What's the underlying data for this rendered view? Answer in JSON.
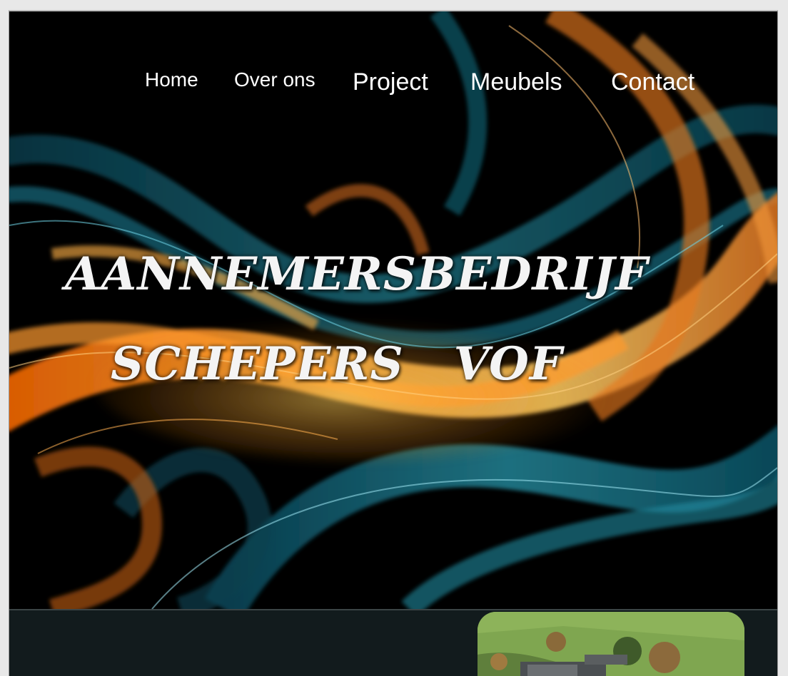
{
  "nav": {
    "items": [
      {
        "label": "Home"
      },
      {
        "label": "Over ons"
      },
      {
        "label": "Project"
      },
      {
        "label": "Meubels"
      },
      {
        "label": "Contact"
      }
    ]
  },
  "hero": {
    "title_line1": "AANNEMERSBEDRIJF",
    "title_line2": "SCHEPERS   VOF"
  },
  "colors": {
    "background": "#000000",
    "section_dark": "#121b1d",
    "swirl_orange": "#f08a24",
    "swirl_teal": "#1f8fa8",
    "text": "#ffffff"
  }
}
